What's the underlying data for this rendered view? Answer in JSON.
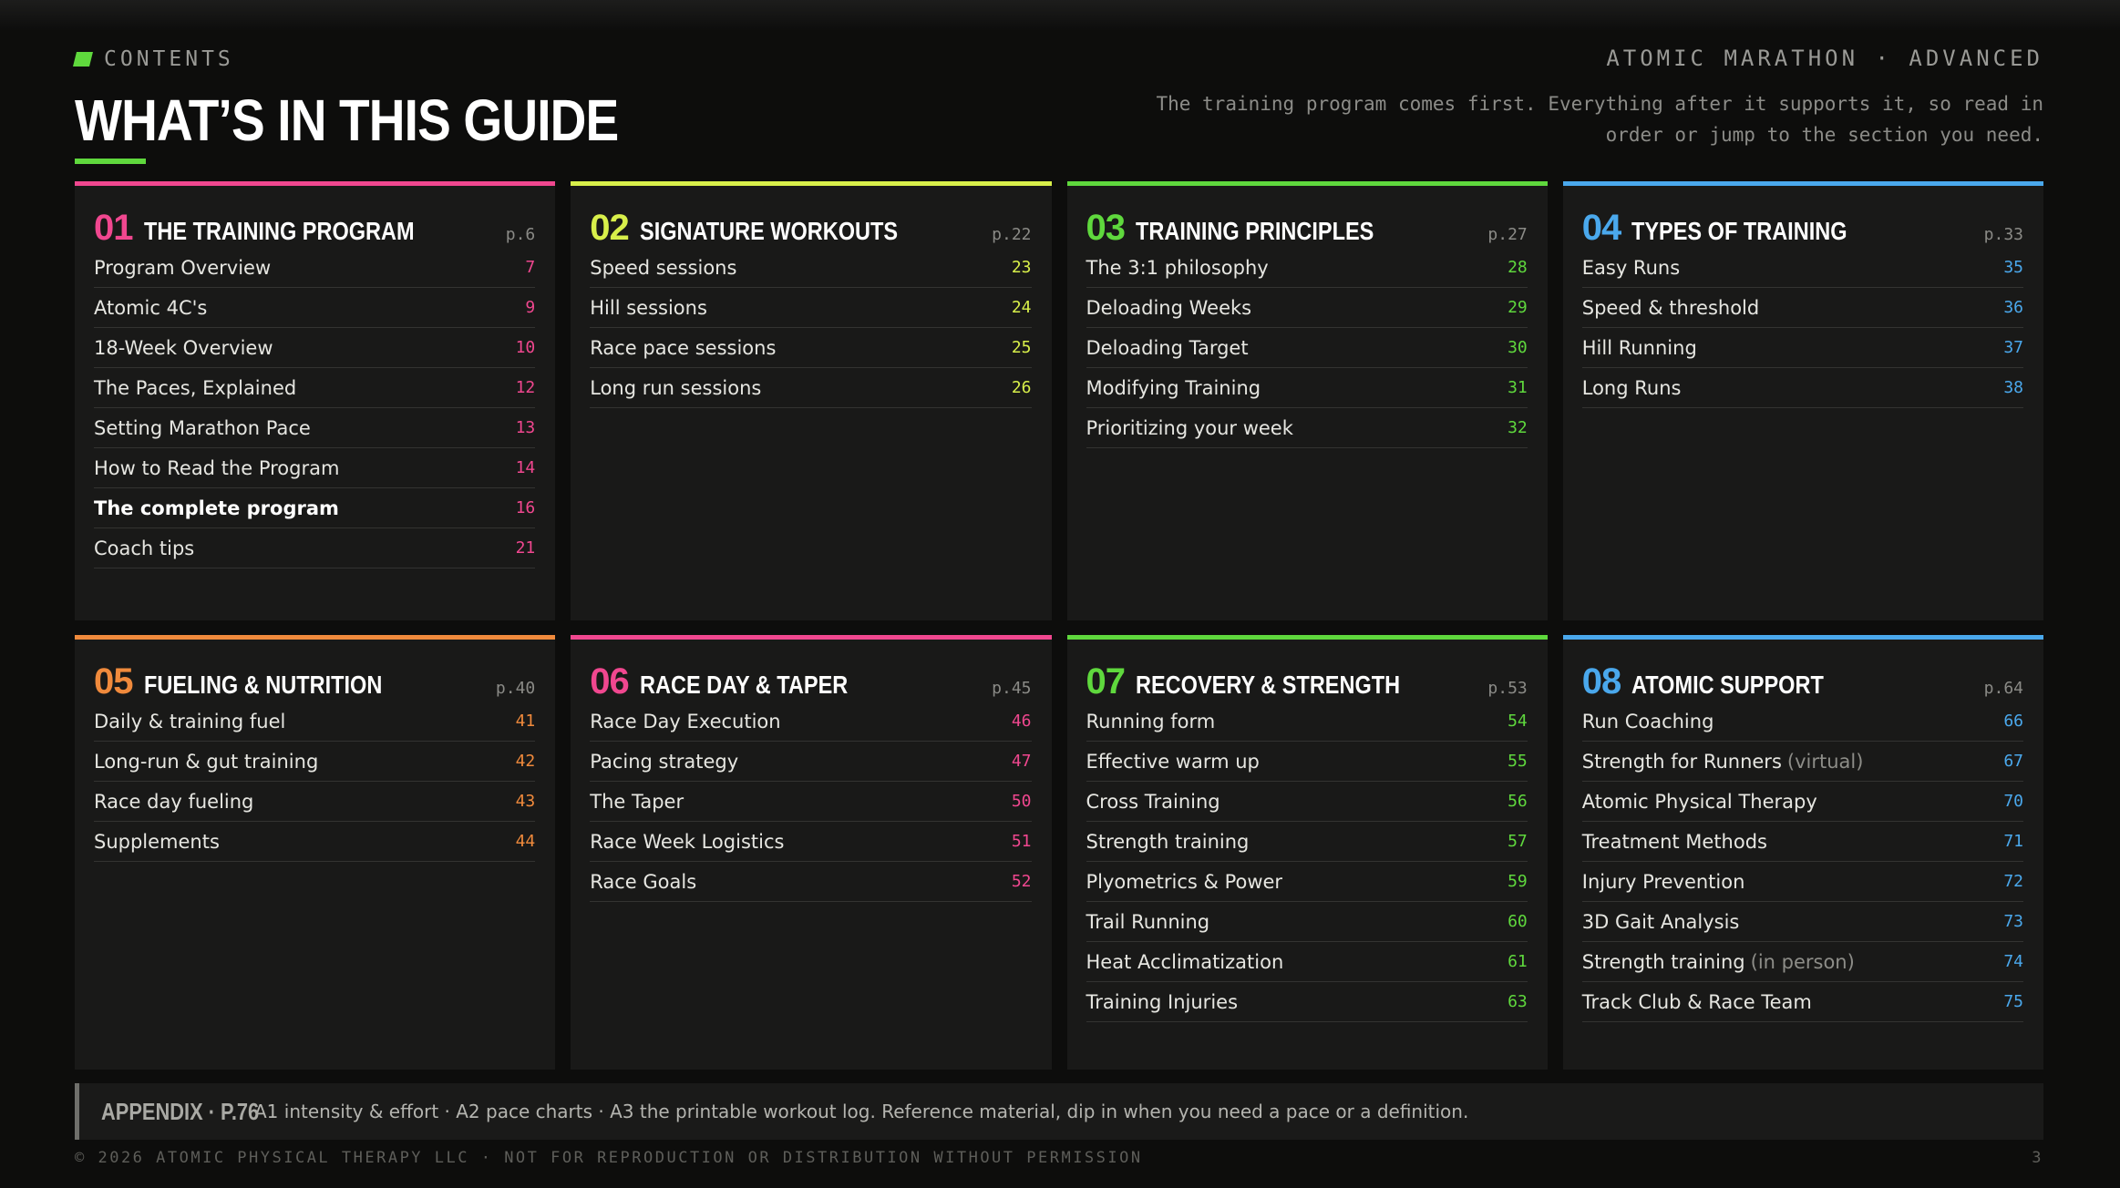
{
  "header": {
    "eyebrow": "CONTENTS",
    "title": "WHAT’S IN THIS GUIDE",
    "edition": "ATOMIC MARATHON · ADVANCED",
    "intro": "The training program comes first. Everything after it supports it, so read in order or jump to the section you need."
  },
  "sections": [
    {
      "num": "01",
      "title": "THE TRAINING PROGRAM",
      "page": "p.6",
      "accent": "#f0478f",
      "items": [
        {
          "label": "Program Overview",
          "page": "7"
        },
        {
          "label": "Atomic 4C's",
          "page": "9"
        },
        {
          "label": "18-Week Overview",
          "page": "10"
        },
        {
          "label": "The Paces, Explained",
          "page": "12"
        },
        {
          "label": "Setting Marathon Pace",
          "page": "13"
        },
        {
          "label": "How to Read the Program",
          "page": "14"
        },
        {
          "label": "The complete program",
          "page": "16",
          "strong": true
        },
        {
          "label": "Coach tips",
          "page": "21"
        }
      ]
    },
    {
      "num": "02",
      "title": "SIGNATURE WORKOUTS",
      "page": "p.22",
      "accent": "#d8ef4a",
      "items": [
        {
          "label": "Speed sessions",
          "page": "23"
        },
        {
          "label": "Hill sessions",
          "page": "24"
        },
        {
          "label": "Race pace sessions",
          "page": "25"
        },
        {
          "label": "Long run sessions",
          "page": "26"
        }
      ]
    },
    {
      "num": "03",
      "title": "TRAINING PRINCIPLES",
      "page": "p.27",
      "accent": "#5fd83d",
      "items": [
        {
          "label": "The 3:1 philosophy",
          "page": "28"
        },
        {
          "label": "Deloading Weeks",
          "page": "29"
        },
        {
          "label": "Deloading Target",
          "page": "30"
        },
        {
          "label": "Modifying Training",
          "page": "31"
        },
        {
          "label": "Prioritizing your week",
          "page": "32"
        }
      ]
    },
    {
      "num": "04",
      "title": "TYPES OF TRAINING",
      "page": "p.33",
      "accent": "#4aa8ec",
      "items": [
        {
          "label": "Easy Runs",
          "page": "35"
        },
        {
          "label": "Speed & threshold",
          "page": "36"
        },
        {
          "label": "Hill Running",
          "page": "37"
        },
        {
          "label": "Long Runs",
          "page": "38"
        }
      ]
    },
    {
      "num": "05",
      "title": "FUELING & NUTRITION",
      "page": "p.40",
      "accent": "#f08a3c",
      "items": [
        {
          "label": "Daily & training fuel",
          "page": "41"
        },
        {
          "label": "Long-run & gut training",
          "page": "42"
        },
        {
          "label": "Race day fueling",
          "page": "43"
        },
        {
          "label": "Supplements",
          "page": "44"
        }
      ]
    },
    {
      "num": "06",
      "title": "RACE DAY & TAPER",
      "page": "p.45",
      "accent": "#f0478f",
      "items": [
        {
          "label": "Race Day Execution",
          "page": "46"
        },
        {
          "label": "Pacing strategy",
          "page": "47"
        },
        {
          "label": "The Taper",
          "page": "50"
        },
        {
          "label": "Race Week Logistics",
          "page": "51"
        },
        {
          "label": "Race Goals",
          "page": "52"
        }
      ]
    },
    {
      "num": "07",
      "title": "RECOVERY & STRENGTH",
      "page": "p.53",
      "accent": "#5fd83d",
      "items": [
        {
          "label": "Running form",
          "page": "54"
        },
        {
          "label": "Effective warm up",
          "page": "55"
        },
        {
          "label": "Cross Training",
          "page": "56"
        },
        {
          "label": "Strength training",
          "page": "57"
        },
        {
          "label": "Plyometrics & Power",
          "page": "59"
        },
        {
          "label": "Trail Running",
          "page": "60"
        },
        {
          "label": "Heat Acclimatization",
          "page": "61"
        },
        {
          "label": "Training Injuries",
          "page": "63"
        }
      ]
    },
    {
      "num": "08",
      "title": "ATOMIC SUPPORT",
      "page": "p.64",
      "accent": "#4aa8ec",
      "items": [
        {
          "label": "Run Coaching",
          "page": "66"
        },
        {
          "label": "Strength for Runners",
          "note": "(virtual)",
          "page": "67"
        },
        {
          "label": "Atomic Physical Therapy",
          "page": "70"
        },
        {
          "label": "Treatment Methods",
          "page": "71"
        },
        {
          "label": "Injury Prevention",
          "page": "72"
        },
        {
          "label": "3D Gait Analysis",
          "page": "73"
        },
        {
          "label": "Strength training",
          "note": "(in person)",
          "page": "74"
        },
        {
          "label": "Track Club & Race Team",
          "page": "75"
        }
      ]
    }
  ],
  "appendix": {
    "label": "APPENDIX · P.76",
    "text": "A1 intensity & effort · A2 pace charts · A3 the printable workout log. Reference material, dip in when you need a pace or a definition."
  },
  "footer": {
    "copyright": "© 2026 ATOMIC PHYSICAL THERAPY LLC · NOT FOR REPRODUCTION OR DISTRIBUTION WITHOUT PERMISSION",
    "page_number": "3"
  }
}
